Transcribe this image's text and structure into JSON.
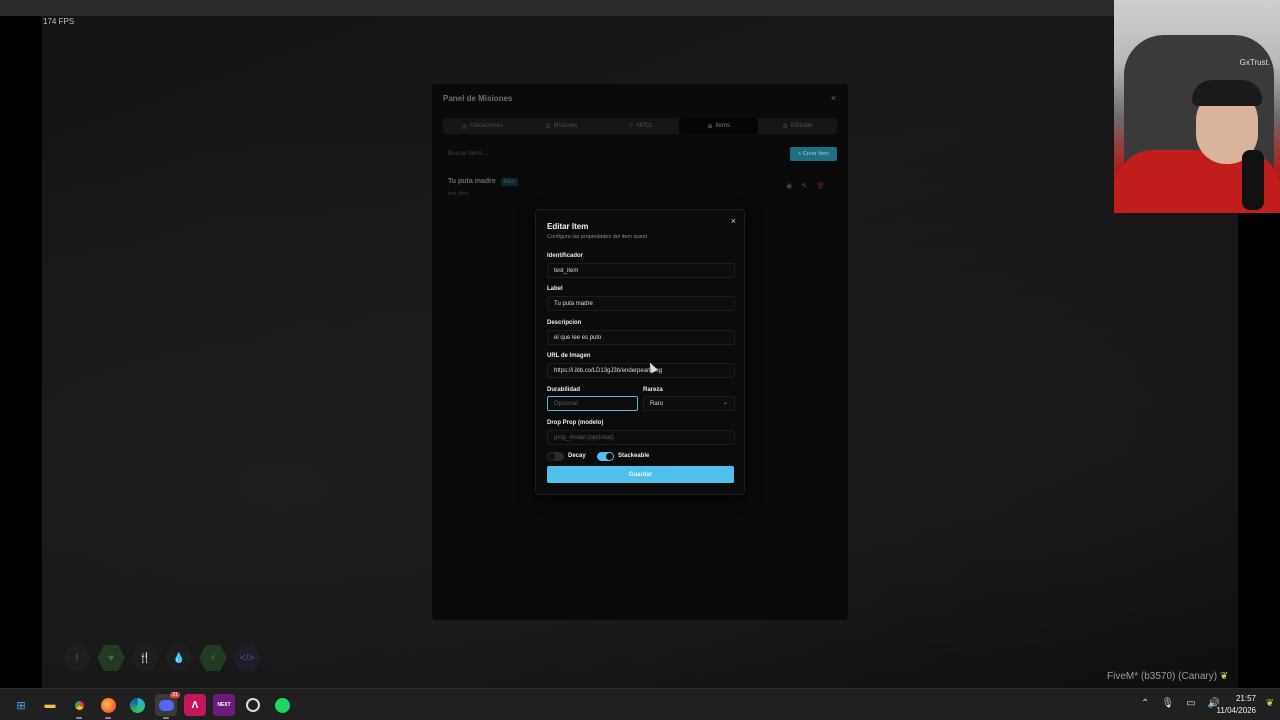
{
  "overlay": {
    "fps": "174 FPS",
    "build": "FiveM* (b3570) (Canary)"
  },
  "webcam": {
    "logo": "GxTrust."
  },
  "panel": {
    "title": "Panel de Misiones",
    "close": "×",
    "tabs": [
      {
        "label": "Ubicaciones",
        "icon": "◎"
      },
      {
        "label": "Misiones",
        "icon": "☰"
      },
      {
        "label": "NPCs",
        "icon": "☺"
      },
      {
        "label": "Items",
        "icon": "⊕"
      },
      {
        "label": "Editable",
        "icon": "⚙"
      }
    ],
    "search_placeholder": "Buscar items...",
    "create_label": "+ Crear Item",
    "item": {
      "name": "Tu puta madre",
      "rarity": "Raro",
      "id": "test_item"
    },
    "actions": {
      "view": "◉",
      "edit": "✎",
      "delete": "🗑"
    }
  },
  "modal": {
    "title": "Editar Item",
    "subtitle": "Configura las propiedades del item quest",
    "close": "×",
    "fields": {
      "identificador": {
        "label": "Identificador",
        "value": "test_item"
      },
      "label": {
        "label": "Label",
        "value": "Tu puta madre"
      },
      "descripcion": {
        "label": "Descripcion",
        "value": "el que lee es puto"
      },
      "url": {
        "label": "URL de Imagen",
        "value": "https://i.ibb.co/LD13gJ3b/enderpearl.png"
      },
      "durabilidad": {
        "label": "Durabilidad",
        "placeholder": "Opcional"
      },
      "rareza": {
        "label": "Rareza",
        "value": "Raro"
      },
      "drop_prop": {
        "label": "Drop Prop (modelo)",
        "placeholder": "prop_model (opcional)"
      }
    },
    "toggles": {
      "decay": {
        "label": "Decay",
        "on": false
      },
      "stackeable": {
        "label": "Stackeable",
        "on": true
      }
    },
    "save_label": "Guardar",
    "accent_color": "#4fc1ea"
  },
  "hud": {
    "icons": [
      "info-icon",
      "heart-icon",
      "food-icon",
      "water-icon",
      "energy-icon",
      "code-icon"
    ]
  },
  "taskbar": {
    "apps": [
      "start-icon",
      "file-explorer-icon",
      "chrome-icon",
      "firefox-icon",
      "edge-icon",
      "discord-icon",
      "app-icon",
      "kick-icon",
      "github-icon",
      "spotify-icon"
    ],
    "discord_badge": "21",
    "time": "21:57",
    "date": "11/04/2026"
  }
}
